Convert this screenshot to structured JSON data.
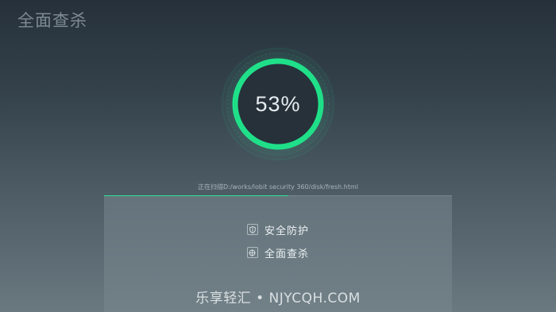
{
  "window": {
    "title": "全面查杀"
  },
  "scan": {
    "percent_text": "53%",
    "progress": 0.53,
    "path_text": "正在扫描D:/works/lobit security 360/disk/fresh.html",
    "accent_color": "#2fe190"
  },
  "panel": {
    "items": [
      {
        "label": "安全防护",
        "icon": "shield-icon"
      },
      {
        "label": "全面查杀",
        "icon": "crosshair-icon"
      }
    ]
  },
  "watermark": {
    "text": "乐享轻汇 • NJYCQH.COM"
  }
}
